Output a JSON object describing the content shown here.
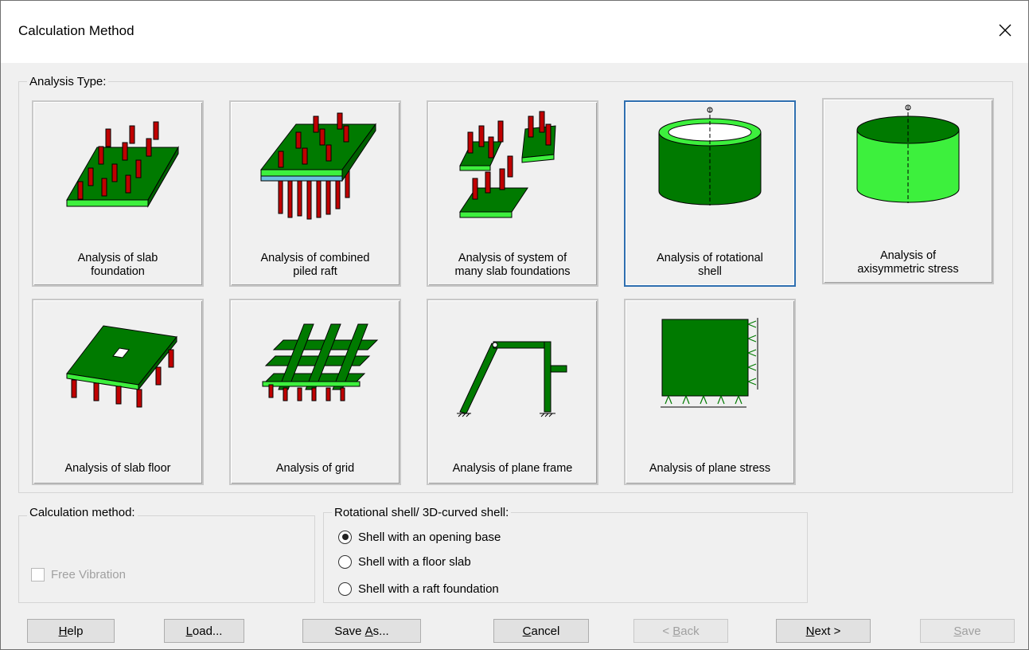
{
  "window": {
    "title": "Calculation Method",
    "close_icon": "close-icon"
  },
  "analysis_group": {
    "label": "Analysis Type:",
    "tiles": [
      {
        "label": "Analysis of slab\nfoundation",
        "icon": "slab-foundation-icon",
        "selected": false
      },
      {
        "label": "Analysis of combined\npiled raft",
        "icon": "piled-raft-icon",
        "selected": false
      },
      {
        "label": "Analysis of system of\nmany slab foundations",
        "icon": "many-slabs-icon",
        "selected": false
      },
      {
        "label": "Analysis of rotational\nshell",
        "icon": "rotational-shell-icon",
        "selected": true
      },
      {
        "label": "Analysis of\naxisymmetric stress",
        "icon": "axisymmetric-icon",
        "selected": false
      },
      {
        "label": "Analysis of slab floor",
        "icon": "slab-floor-icon",
        "selected": false
      },
      {
        "label": "Analysis of grid",
        "icon": "grid-icon",
        "selected": false
      },
      {
        "label": "Analysis of plane frame",
        "icon": "plane-frame-icon",
        "selected": false
      },
      {
        "label": "Analysis of plane stress",
        "icon": "plane-stress-icon",
        "selected": false
      }
    ]
  },
  "calc_group": {
    "label": "Calculation method:",
    "free_vibration": {
      "label": "Free Vibration",
      "checked": false,
      "enabled": false
    }
  },
  "shell_group": {
    "label": "Rotational shell/ 3D-curved shell:",
    "options": [
      {
        "label": "Shell with an opening base",
        "checked": true
      },
      {
        "label": "Shell with a floor slab",
        "checked": false
      },
      {
        "label": "Shell with a raft foundation",
        "checked": false
      }
    ]
  },
  "buttons": {
    "help": {
      "mnemonic": "H",
      "rest": "elp"
    },
    "load": {
      "mnemonic": "L",
      "rest": "oad..."
    },
    "save_as": {
      "pre": "Save ",
      "mnemonic": "A",
      "rest": "s..."
    },
    "cancel": {
      "mnemonic": "C",
      "rest": "ancel"
    },
    "back": {
      "pre": "< ",
      "mnemonic": "B",
      "rest": "ack"
    },
    "next": {
      "mnemonic": "N",
      "rest": "ext >"
    },
    "save": {
      "mnemonic": "S",
      "rest": "ave"
    }
  },
  "colors": {
    "dark_green": "#007a00",
    "light_green": "#3df03d",
    "pile_red": "#c00000",
    "selected_border": "#2f6fb0"
  }
}
